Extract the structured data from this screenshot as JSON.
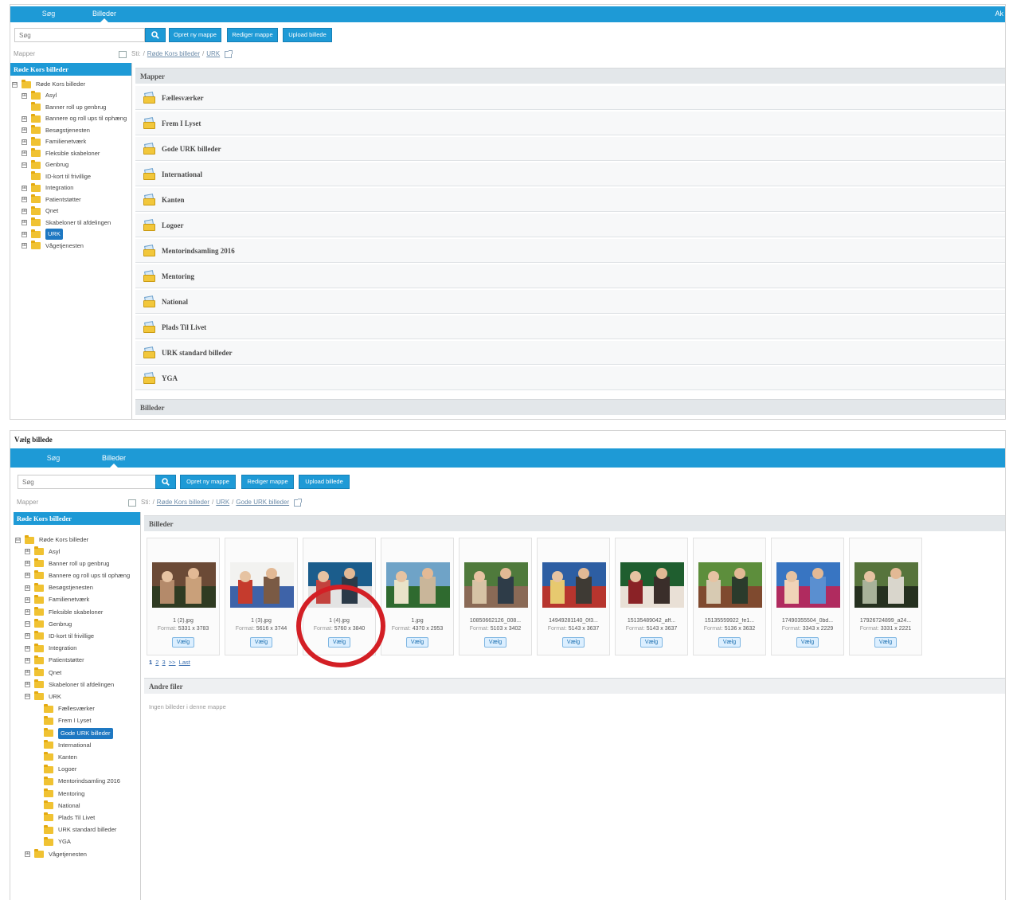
{
  "tabs": {
    "search": "Søg",
    "images": "Billeder"
  },
  "corner_text": "Ak",
  "search": {
    "placeholder": "Søg"
  },
  "toolbar": {
    "new_folder": "Opret ny mappe",
    "edit_folder": "Rediger mappe",
    "upload": "Upload billede"
  },
  "mapper_label": "Mapper",
  "path": {
    "prefix": "Sti:",
    "root": "Røde Kors billeder",
    "urk": "URK",
    "subfolder": "Gode URK billeder"
  },
  "sidebar_title": "Røde Kors billeder",
  "tree_root": "Røde Kors billeder",
  "tree_items": [
    "Asyl",
    "Banner roll up genbrug",
    "Bannere og roll ups til ophæng",
    "Besøgstjenesten",
    "Familienetværk",
    "Fleksible skabeloner",
    "Genbrug",
    "ID-kort til frivillige",
    "Integration",
    "Patientstøtter",
    "Qnet",
    "Skabeloner til afdelingen",
    "URK",
    "Vågetjenesten"
  ],
  "urk_children": [
    "Fællesværker",
    "Frem I Lyset",
    "Gode URK billeder",
    "International",
    "Kanten",
    "Logoer",
    "Mentorindsamling 2016",
    "Mentoring",
    "National",
    "Plads Til Livet",
    "URK standard billeder",
    "YGA"
  ],
  "panel1": {
    "mapper_header": "Mapper",
    "folders": [
      "Fællesværker",
      "Frem I Lyset",
      "Gode URK billeder",
      "International",
      "Kanten",
      "Logoer",
      "Mentorindsamling 2016",
      "Mentoring",
      "National",
      "Plads Til Livet",
      "URK standard billeder",
      "YGA"
    ],
    "images_header": "Billeder"
  },
  "panel2": {
    "title": "Vælg billede",
    "images_header": "Billeder",
    "format_label": "Format:",
    "select_label": "Vælg",
    "images": [
      {
        "name": "1 (2).jpg",
        "format": "5331 x 3783"
      },
      {
        "name": "1 (3).jpg",
        "format": "5616 x 3744"
      },
      {
        "name": "1 (4).jpg",
        "format": "5760 x 3840"
      },
      {
        "name": "1.jpg",
        "format": "4370 x 2953"
      },
      {
        "name": "10850662126_008...",
        "format": "5103 x 3402"
      },
      {
        "name": "14949281140_0f3...",
        "format": "5143 x 3637"
      },
      {
        "name": "15135489042_aff...",
        "format": "5143 x 3637"
      },
      {
        "name": "15135559922_fe1...",
        "format": "5136 x 3632"
      },
      {
        "name": "17490355504_0bd...",
        "format": "3343 x 2229"
      },
      {
        "name": "17926724899_a24...",
        "format": "3331 x 2221"
      }
    ],
    "pagination": {
      "pages": [
        "1",
        "2",
        "3"
      ],
      "next": ">>",
      "last": "Last"
    },
    "other_files_header": "Andre filer",
    "other_files_empty": "Ingen billeder i denne mappe"
  },
  "colors": {
    "accent": "#1e9ad6",
    "highlight": "#d31f25",
    "folder": "#f0c232"
  }
}
